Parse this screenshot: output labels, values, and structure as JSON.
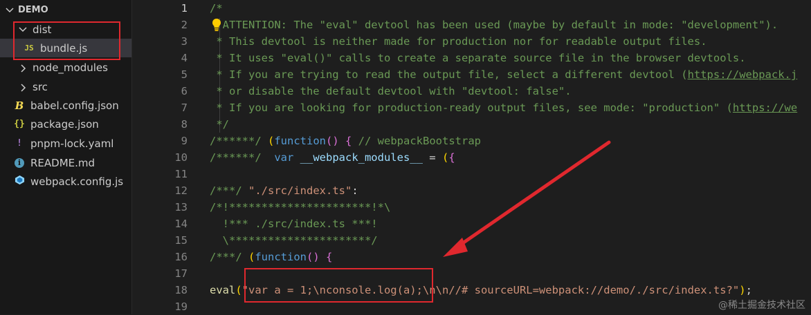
{
  "explorer": {
    "root_label": "DEMO",
    "items": [
      {
        "label": "dist",
        "kind": "folder-open",
        "icon_text": ""
      },
      {
        "label": "bundle.js",
        "kind": "file-js",
        "icon_text": "JS"
      },
      {
        "label": "node_modules",
        "kind": "folder",
        "icon_text": ""
      },
      {
        "label": "src",
        "kind": "folder",
        "icon_text": ""
      },
      {
        "label": "babel.config.json",
        "kind": "file-babel",
        "icon_text": "B"
      },
      {
        "label": "package.json",
        "kind": "file-json",
        "icon_text": "{}"
      },
      {
        "label": "pnpm-lock.yaml",
        "kind": "file-yaml",
        "icon_text": "!"
      },
      {
        "label": "README.md",
        "kind": "file-info",
        "icon_text": "i"
      },
      {
        "label": "webpack.config.js",
        "kind": "file-webpack",
        "icon_text": ""
      }
    ]
  },
  "editor": {
    "line_numbers": [
      "1",
      "2",
      "3",
      "4",
      "5",
      "6",
      "7",
      "8",
      "9",
      "10",
      "11",
      "12",
      "13",
      "14",
      "15",
      "16",
      "17",
      "18",
      "19"
    ],
    "lines": [
      [
        {
          "t": "/*",
          "c": "cm"
        }
      ],
      [
        {
          "t": "  ATTENTION: The \"eval\" devtool has been used (maybe by default in mode: \"development\").",
          "c": "cm"
        }
      ],
      [
        {
          "t": " * This devtool is neither made for production nor for readable output files.",
          "c": "cm"
        }
      ],
      [
        {
          "t": " * It uses \"eval()\" calls to create a separate source file in the browser devtools.",
          "c": "cm"
        }
      ],
      [
        {
          "t": " * If you are trying to read the output file, select a different devtool (",
          "c": "cm"
        },
        {
          "t": "https://webpack.j",
          "c": "cm ul"
        }
      ],
      [
        {
          "t": " * or disable the default devtool with \"devtool: false\".",
          "c": "cm"
        }
      ],
      [
        {
          "t": " * If you are looking for production-ready output files, see mode: \"production\" (",
          "c": "cm"
        },
        {
          "t": "https://we",
          "c": "cm ul"
        }
      ],
      [
        {
          "t": " */",
          "c": "cm"
        }
      ],
      [
        {
          "t": "/******/ ",
          "c": "cm"
        },
        {
          "t": "(",
          "c": "br1"
        },
        {
          "t": "function",
          "c": "kw"
        },
        {
          "t": "() ",
          "c": "br2"
        },
        {
          "t": "{",
          "c": "br2"
        },
        {
          "t": " // webpackBootstrap",
          "c": "cm"
        }
      ],
      [
        {
          "t": "/******/  ",
          "c": "cm"
        },
        {
          "t": "var",
          "c": "kw"
        },
        {
          "t": " __webpack_modules__",
          "c": "vr"
        },
        {
          "t": " = ",
          "c": "pl"
        },
        {
          "t": "(",
          "c": "br1"
        },
        {
          "t": "{",
          "c": "br2"
        }
      ],
      [
        {
          "t": "",
          "c": "pl"
        }
      ],
      [
        {
          "t": "/***/ ",
          "c": "cm"
        },
        {
          "t": "\"./src/index.ts\"",
          "c": "st"
        },
        {
          "t": ":",
          "c": "pl"
        }
      ],
      [
        {
          "t": "/*!**********************!*\\",
          "c": "cm"
        }
      ],
      [
        {
          "t": "  !*** ./src/index.ts ***!",
          "c": "cm"
        }
      ],
      [
        {
          "t": "  \\**********************/",
          "c": "cm"
        }
      ],
      [
        {
          "t": "/***/ ",
          "c": "cm"
        },
        {
          "t": "(",
          "c": "br1"
        },
        {
          "t": "function",
          "c": "kw"
        },
        {
          "t": "() ",
          "c": "br2"
        },
        {
          "t": "{",
          "c": "br2"
        }
      ],
      [
        {
          "t": "",
          "c": "pl"
        }
      ],
      [
        {
          "t": "eval",
          "c": "fn"
        },
        {
          "t": "(",
          "c": "br1"
        },
        {
          "t": "\"var a = 1;\\nconsole.log(a);\\n\\n//# sourceURL=webpack://demo/./src/index.ts?\"",
          "c": "st"
        },
        {
          "t": ")",
          "c": "br1"
        },
        {
          "t": ";",
          "c": "pl"
        }
      ],
      [
        {
          "t": "",
          "c": "pl"
        }
      ]
    ],
    "active_line": "1"
  },
  "watermark": "@稀土掘金技术社区",
  "colors": {
    "highlight_box": "#e0282e",
    "arrow": "#e0282e",
    "comment": "#6a9955",
    "keyword": "#569cd6",
    "string": "#ce9178"
  },
  "icons": {
    "lightbulb": "lightbulb-icon",
    "chevron_down": "chevron-down-icon",
    "chevron_right": "chevron-right-icon"
  }
}
